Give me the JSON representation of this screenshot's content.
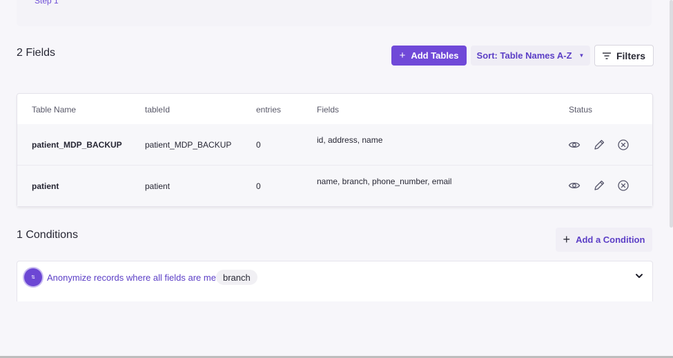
{
  "top_card": {
    "partial_text": "Step 1"
  },
  "fields_section": {
    "count_label": "2 Fields",
    "add_tables_label": "Add Tables",
    "sort_label": "Sort: Table Names A-Z",
    "filters_label": "Filters"
  },
  "table": {
    "headers": [
      "Table Name",
      "tableId",
      "entries",
      "Fields",
      "Status"
    ],
    "rows": [
      {
        "table_name": "patient_MDP_BACKUP",
        "table_id": "patient_MDP_BACKUP",
        "entries": "0",
        "fields": "id, address, name"
      },
      {
        "table_name": "patient",
        "table_id": "patient",
        "entries": "0",
        "fields": "name, branch, phone_number, email"
      }
    ]
  },
  "conditions_section": {
    "count_label": "1 Conditions",
    "add_condition_label": "Add a Condition",
    "condition": {
      "avatar_text": "⇅",
      "text": "Anonymize records where all fields are met",
      "chip": "branch"
    }
  },
  "colors": {
    "accent": "#7049d8",
    "accent_text": "#5b3ec6",
    "background": "#f7f6fa"
  },
  "icons": [
    "plus-icon",
    "chevron-down-icon",
    "filter-icon",
    "eye-icon",
    "pencil-icon",
    "close-circle-icon",
    "sort-avatar-icon"
  ]
}
